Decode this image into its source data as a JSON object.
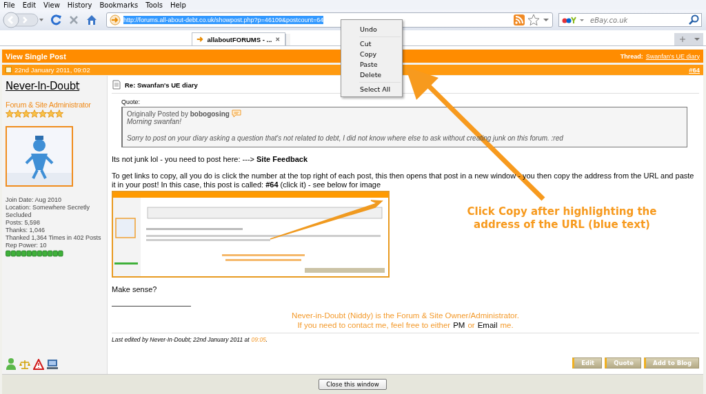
{
  "menu_bar": [
    {
      "label": "File"
    },
    {
      "label": "Edit"
    },
    {
      "label": "View"
    },
    {
      "label": "History"
    },
    {
      "label": "Bookmarks"
    },
    {
      "label": "Tools"
    },
    {
      "label": "Help"
    }
  ],
  "address_bar": {
    "url": "http://forums.all-about-debt.co.uk/showpost.php?p=46109&postcount=64",
    "selected": true
  },
  "search_box": {
    "placeholder": "eBay.co.uk"
  },
  "tabs": [
    {
      "label": "allaboutFORUMS - ...",
      "selected": true
    }
  ],
  "context_menu": [
    {
      "kind": "item",
      "label": "Undo"
    },
    {
      "kind": "separator"
    },
    {
      "kind": "item",
      "label": "Cut"
    },
    {
      "kind": "item",
      "label": "Copy"
    },
    {
      "kind": "item",
      "label": "Paste"
    },
    {
      "kind": "item",
      "label": "Delete"
    },
    {
      "kind": "separator"
    },
    {
      "kind": "item",
      "label": "Select All"
    }
  ],
  "page_header": {
    "title": "View Single Post",
    "thread_label": "Thread:",
    "thread_link": "Swanfan's UE diary"
  },
  "post": {
    "date": "22nd January 2011, 09:02",
    "number": "#64",
    "user": {
      "name": "Never-In-Doubt",
      "title": "Forum & Site Administrator",
      "stars": 7,
      "avatar": {
        "kind": "picture"
      },
      "info": [
        "Join Date: Aug 2010",
        "Location: Somewhere Secretly Secluded",
        "Posts: 5,598",
        "Thanks: 1,046",
        "Thanked 1,364 Times in 402 Posts",
        "Rep Power: 10"
      ]
    },
    "message": {
      "title": "Re: Swanfan's UE diary",
      "quote_label": "Quote:",
      "quote": {
        "attribution": "Originally Posted by **bobogosing**",
        "lines": [
          "Morning swanfan!",
          "Sorry to post on your diary asking a question that's not related to debt, I did not know where else to ask without creating junk on this forum. :red"
        ]
      },
      "paragraphs": [
        "Its not junk lol - you need to post here: ---> **Site Feedback**",
        "To get links to copy, all you do is click the number at the top right of each post, this then opens that post in a new window - you then copy the address from the URL and paste it in your post! In this case, this post is called: **#64** (click it) - see below for image"
      ],
      "image": {
        "kind": "picture"
      },
      "closing": "Make sense?",
      "signature": [
        [
          {
            "kind": "plain",
            "text": "Never-in-Doubt (Niddy) is the Forum & Site Owner/Administrator."
          }
        ],
        [
          {
            "kind": "plain",
            "text": "If you need to contact me, feel free to either"
          },
          {
            "kind": "link",
            "text": "PM"
          },
          {
            "kind": "plain",
            "text": "or"
          },
          {
            "kind": "link",
            "text": "Email"
          },
          {
            "kind": "plain",
            "text": "me."
          }
        ]
      ],
      "edited": {
        "prefix": "Last edited by Never-In-Doubt; 22nd January 2011 at",
        "time": "09:05",
        "suffix": "."
      },
      "buttons": [
        "Edit",
        "Quote",
        "Add to Blog"
      ]
    }
  },
  "annotation": {
    "text": "Click Copy after highlighting the address of the URL (blue text)"
  },
  "footer": {
    "button": "Close this window"
  }
}
